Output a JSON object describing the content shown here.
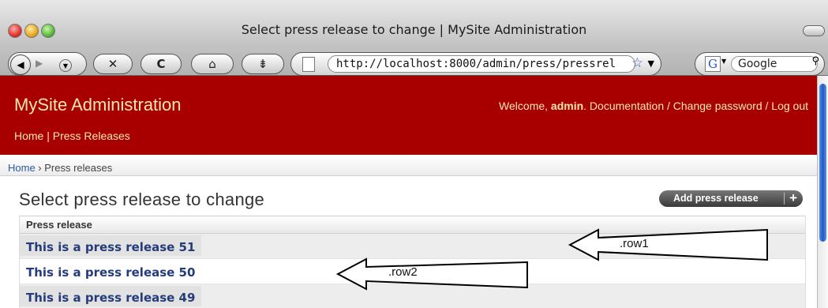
{
  "window": {
    "title": "Select press release to change | MySite Administration"
  },
  "toolbar": {
    "url": "http://localhost:8000/admin/press/pressrel",
    "search_engine": "Google"
  },
  "admin": {
    "site_title": "MySite Administration",
    "welcome": "Welcome,",
    "username": "admin",
    "user_links": ". Documentation / Change password / Log out",
    "nav": "Home | Press Releases",
    "breadcrumb_home": "Home",
    "breadcrumb_sep": " › ",
    "breadcrumb_current": "Press releases",
    "page_title": "Select press release to change",
    "add_button": "Add press release",
    "column_header": "Press release",
    "rows": [
      {
        "title": "This is a press release 51",
        "class": "row1"
      },
      {
        "title": "This is a press release 50",
        "class": "row2"
      },
      {
        "title": "This is a press release 49",
        "class": "row1"
      }
    ]
  },
  "annotations": {
    "row1_label": ".row1",
    "row2_label": ".row2"
  }
}
